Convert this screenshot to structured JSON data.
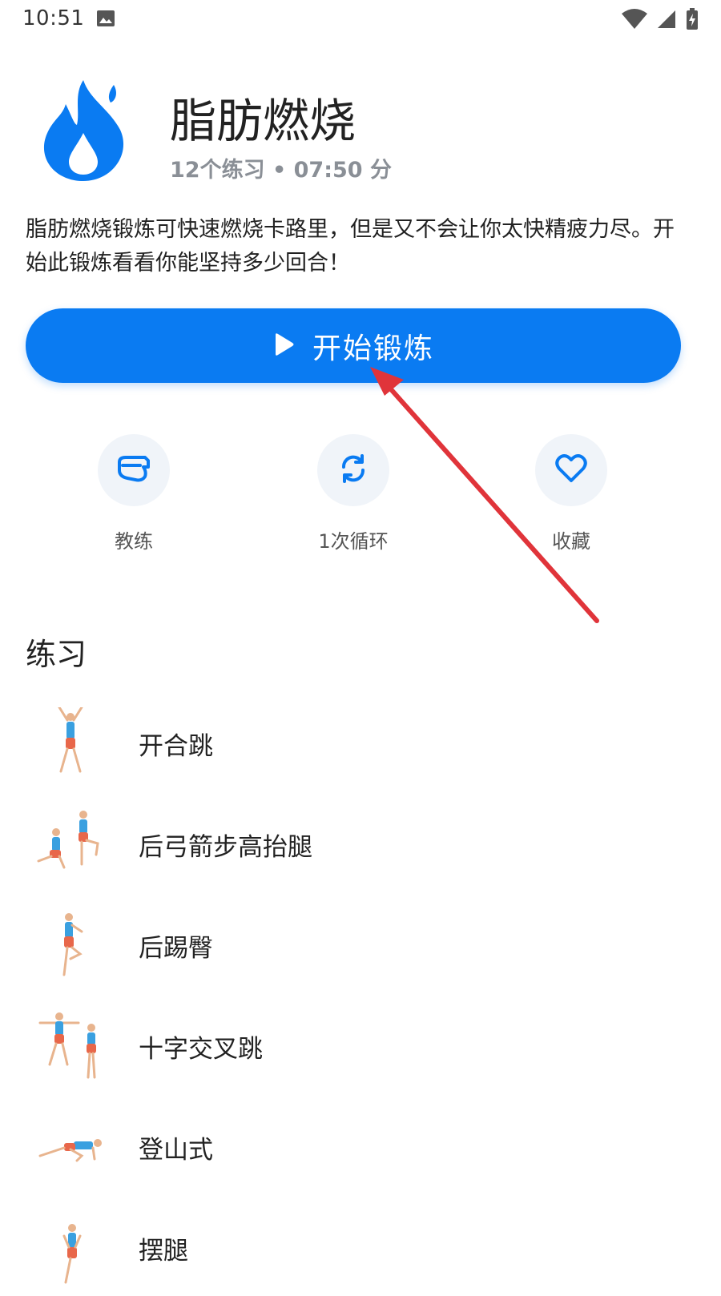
{
  "status_bar": {
    "time": "10:51",
    "icons": [
      "image-icon",
      "wifi-icon",
      "signal-icon",
      "battery-icon"
    ]
  },
  "header": {
    "icon": "flame-icon",
    "title": "脂肪燃烧",
    "meta": "12个练习 • 07:50 分"
  },
  "description": "脂肪燃烧锻炼可快速燃烧卡路里，但是又不会让你太快精疲力尽。开始此锻炼看看你能坚持多少回合！",
  "start_button": {
    "label": "开始锻炼",
    "icon": "play-icon"
  },
  "actions": [
    {
      "label": "教练",
      "icon": "whistle-icon"
    },
    {
      "label": "1次循环",
      "icon": "repeat-icon"
    },
    {
      "label": "收藏",
      "icon": "heart-icon"
    }
  ],
  "section_title": "练习",
  "exercises": [
    {
      "name": "开合跳"
    },
    {
      "name": "后弓箭步高抬腿"
    },
    {
      "name": "后踢臀"
    },
    {
      "name": "十字交叉跳"
    },
    {
      "name": "登山式"
    },
    {
      "name": "摆腿"
    }
  ],
  "colors": {
    "accent": "#0a7bf2",
    "annotation_arrow": "#e0343a",
    "action_bg": "#f0f4f9"
  }
}
